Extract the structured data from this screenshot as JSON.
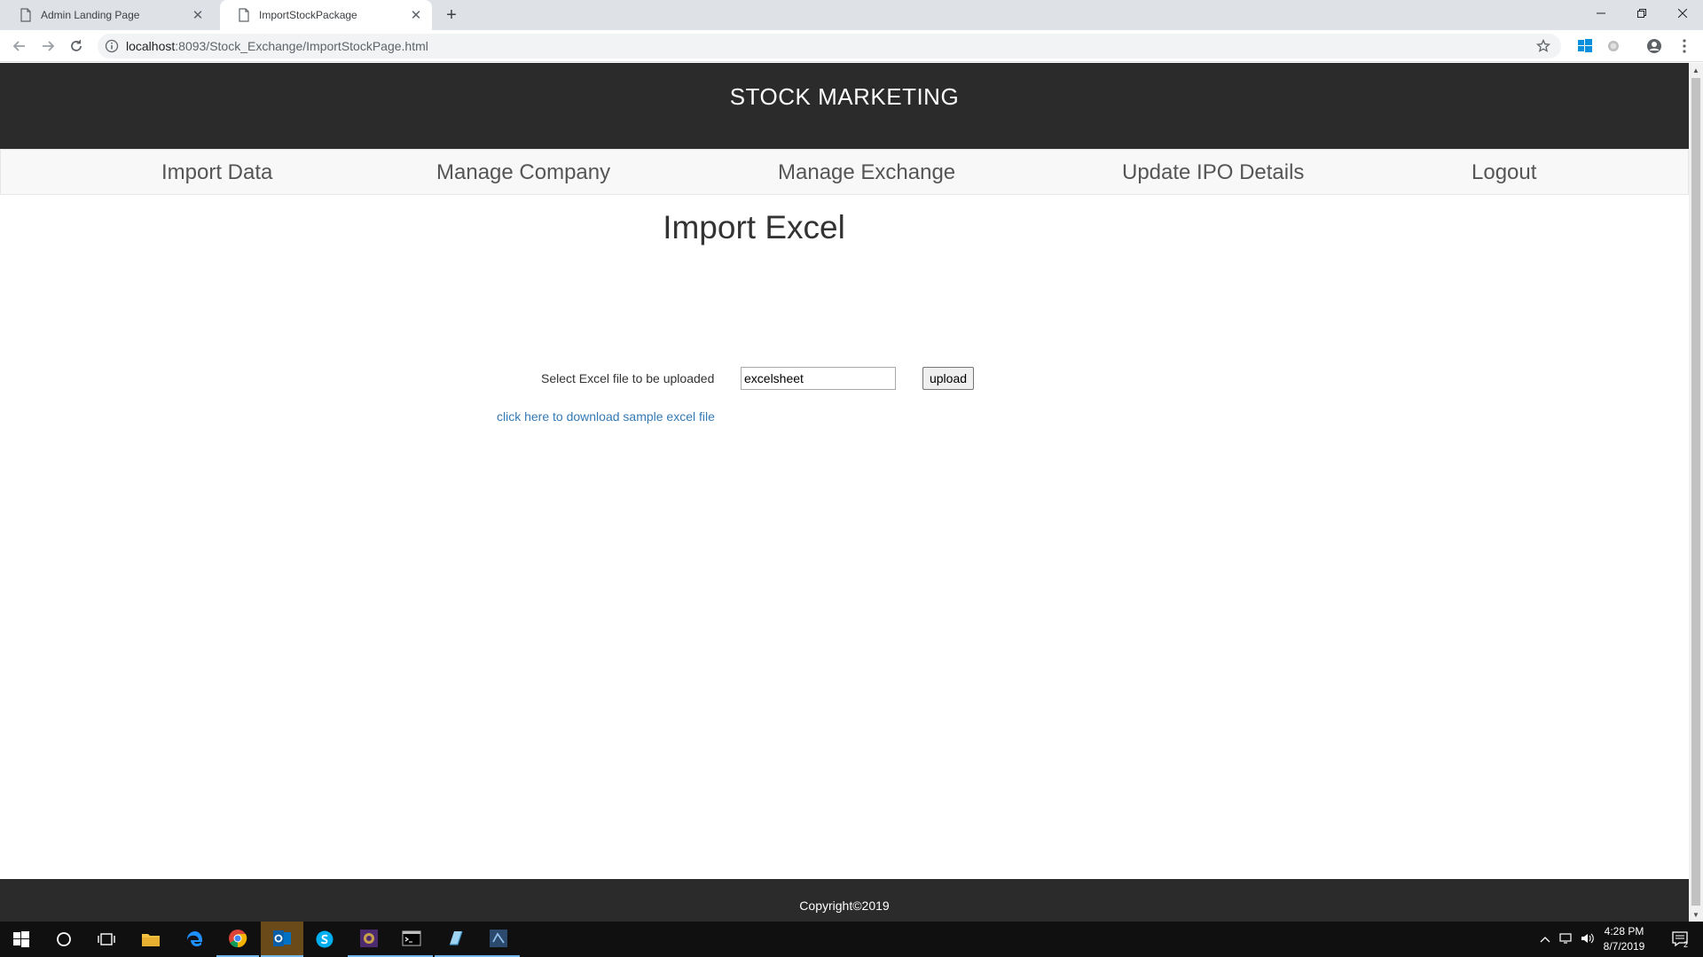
{
  "browser": {
    "tabs": [
      {
        "title": "Admin Landing Page",
        "active": false
      },
      {
        "title": "ImportStockPackage",
        "active": true
      }
    ],
    "url_host": "localhost",
    "url_rest": ":8093/Stock_Exchange/ImportStockPage.html"
  },
  "site": {
    "title": "STOCK MARKETING",
    "nav": [
      "Import Data",
      "Manage Company",
      "Manage Exchange",
      "Update IPO Details",
      "Logout"
    ],
    "heading": "Import Excel",
    "form": {
      "label": "Select Excel file to be uploaded",
      "file_value": "excelsheet",
      "upload_label": "upload",
      "download_link": "click here to download sample excel file"
    },
    "footer": "Copyright©2019"
  },
  "taskbar": {
    "time": "4:28 PM",
    "date": "8/7/2019",
    "notification_count": "2"
  },
  "colors": {
    "header_bg": "#2b2b2b",
    "nav_bg": "#f8f8f8",
    "link": "#337ab7"
  }
}
